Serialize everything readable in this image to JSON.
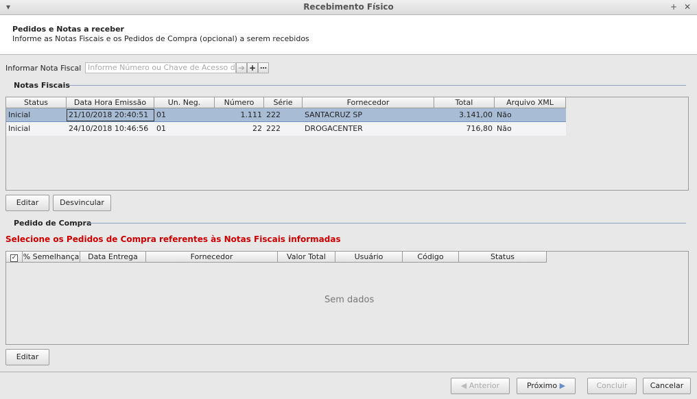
{
  "window": {
    "title": "Recebimento Físico"
  },
  "header": {
    "title": "Pedidos e Notas a receber",
    "subtitle": "Informe as Notas Fiscais e os Pedidos de Compra (opcional) a serem recebidos"
  },
  "nf_input": {
    "label": "Informar Nota Fiscal",
    "placeholder": "Informe Número ou Chave de Acesso da"
  },
  "notas": {
    "section_title": "Notas Fiscais",
    "columns": [
      "Status",
      "Data Hora Emissão",
      "Un. Neg.",
      "Número",
      "Série",
      "Fornecedor",
      "Total",
      "Arquivo XML"
    ],
    "rows": [
      [
        "Inicial",
        "21/10/2018 20:40:51",
        "01",
        "1.111",
        "222",
        "SANTACRUZ SP",
        "3.141,00",
        "Não"
      ],
      [
        "Inicial",
        "24/10/2018 10:46:56",
        "01",
        "22",
        "222",
        "DROGACENTER",
        "716,80",
        "Não"
      ]
    ],
    "edit_label": "Editar",
    "unlink_label": "Desvincular"
  },
  "pedidos": {
    "section_title": "Pedido de Compra",
    "warning": "Selecione os Pedidos de Compra referentes às Notas Fiscais informadas",
    "columns": [
      "% Semelhança",
      "Data Entrega",
      "Fornecedor",
      "Valor Total",
      "Usuário",
      "Código",
      "Status"
    ],
    "empty_text": "Sem dados",
    "edit_label": "Editar"
  },
  "footer": {
    "prev_label": "Anterior",
    "next_label": "Próximo",
    "finish_label": "Concluir",
    "cancel_label": "Cancelar"
  }
}
